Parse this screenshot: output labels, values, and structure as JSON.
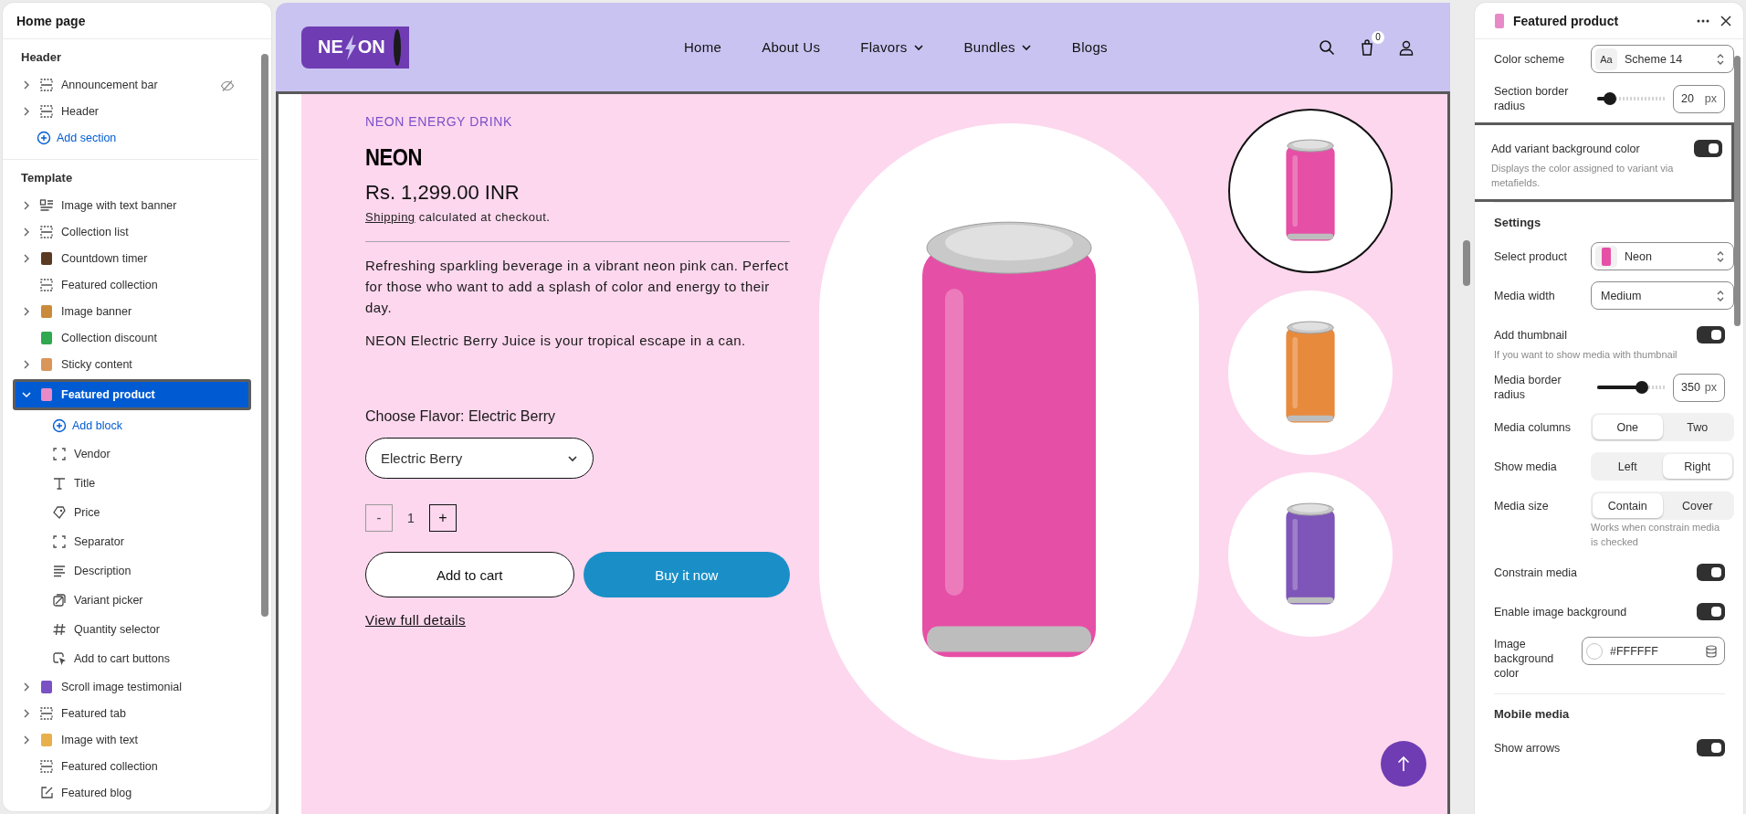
{
  "sidebar": {
    "title": "Home page",
    "groups": [
      {
        "title": "Header",
        "add_label": "Add section",
        "items": [
          {
            "label": "Announcement bar",
            "kind": "section",
            "expanded": false,
            "hidden": true,
            "selected": false
          },
          {
            "label": "Header",
            "kind": "section",
            "expanded": false,
            "hidden": false,
            "selected": false
          }
        ]
      },
      {
        "title": "Template",
        "items": [
          {
            "label": "Image with text banner",
            "kind": "image-text",
            "expanded": false,
            "hidden": false,
            "selected": false
          },
          {
            "label": "Collection list",
            "kind": "section",
            "expanded": false,
            "hidden": false,
            "selected": false
          },
          {
            "label": "Countdown timer",
            "kind": "thumb",
            "color": "#5a3a22",
            "expanded": false,
            "hidden": false,
            "selected": false
          },
          {
            "label": "Featured collection",
            "kind": "section",
            "hidden": false,
            "selected": false
          },
          {
            "label": "Image banner",
            "kind": "thumb",
            "color": "#c98a3a",
            "expanded": false,
            "hidden": false,
            "selected": false
          },
          {
            "label": "Collection discount",
            "kind": "thumb",
            "color": "#2fa84f",
            "hidden": false,
            "selected": false
          },
          {
            "label": "Sticky content",
            "kind": "thumb",
            "color": "#d9965a",
            "expanded": false,
            "hidden": false,
            "selected": false
          },
          {
            "label": "Featured product",
            "kind": "thumb",
            "color": "#e98ac8",
            "expanded": true,
            "hidden": false,
            "selected": true,
            "add_label": "Add block",
            "children": [
              {
                "label": "Vendor",
                "kind": "block",
                "selected": false
              },
              {
                "label": "Title",
                "kind": "text",
                "selected": false
              },
              {
                "label": "Price",
                "kind": "price",
                "selected": false
              },
              {
                "label": "Separator",
                "kind": "block",
                "selected": false
              },
              {
                "label": "Description",
                "kind": "description",
                "selected": false
              },
              {
                "label": "Variant picker",
                "kind": "variant",
                "selected": false
              },
              {
                "label": "Quantity selector",
                "kind": "hash",
                "selected": false
              },
              {
                "label": "Add to cart buttons",
                "kind": "cursor",
                "selected": false
              }
            ]
          },
          {
            "label": "Scroll image testimonial",
            "kind": "thumb",
            "color": "#7a52c4",
            "expanded": false,
            "hidden": false,
            "selected": false
          },
          {
            "label": "Featured tab",
            "kind": "section",
            "expanded": false,
            "hidden": false,
            "selected": false
          },
          {
            "label": "Image with text",
            "kind": "thumb",
            "color": "#e8b04a",
            "expanded": false,
            "hidden": false,
            "selected": false
          },
          {
            "label": "Featured collection",
            "kind": "section",
            "hidden": false,
            "selected": false
          },
          {
            "label": "Featured blog",
            "kind": "edit",
            "hidden": false,
            "selected": false
          }
        ]
      }
    ]
  },
  "store": {
    "logo": {
      "left": "NE",
      "right": "ON"
    },
    "nav": [
      {
        "label": "Home",
        "dropdown": false
      },
      {
        "label": "About Us",
        "dropdown": false
      },
      {
        "label": "Flavors",
        "dropdown": true
      },
      {
        "label": "Bundles",
        "dropdown": true
      },
      {
        "label": "Blogs",
        "dropdown": false
      }
    ],
    "cart_count": "0",
    "product": {
      "vendor": "NEON ENERGY DRINK",
      "title": "NEON",
      "price": "Rs. 1,299.00 INR",
      "shipping_link": "Shipping",
      "shipping_text": "calculated at checkout.",
      "description": [
        "Refreshing sparkling beverage in a vibrant neon pink can. Perfect for those who want to add a splash of color and energy to their day.",
        "NEON Electric Berry Juice is your tropical escape in a can."
      ],
      "option_label": "Choose Flavor:",
      "option_value": "Electric Berry",
      "select_value": "Electric Berry",
      "minus": "-",
      "quantity": "1",
      "plus": "+",
      "add_to_cart": "Add to cart",
      "buy_now": "Buy it now",
      "details_link": "View full details",
      "thumbnails": [
        {
          "color": "#e64fa6",
          "selected": true
        },
        {
          "color": "#e88a3c",
          "selected": false
        },
        {
          "color": "#7e55b8",
          "selected": false
        }
      ]
    }
  },
  "panel": {
    "title": "Featured product",
    "settings": [
      {
        "kind": "select",
        "label": "Color scheme",
        "value": "Scheme 14",
        "badge": "Aa",
        "highlighted": false
      },
      {
        "kind": "slider",
        "label": "Section border radius",
        "level": 0.18,
        "value": "20",
        "unit": "px",
        "highlighted": false
      },
      {
        "kind": "toggle",
        "label": "Add variant background color",
        "on": true,
        "help": "Displays the color assigned to variant via metafields.",
        "highlighted": true
      },
      {
        "kind": "heading",
        "label": "Settings",
        "highlighted": false
      },
      {
        "kind": "select",
        "label": "Select product",
        "value": "Neon",
        "highlighted": false
      },
      {
        "kind": "select",
        "label": "Media width",
        "value": "Medium",
        "highlighted": false
      },
      {
        "kind": "toggle",
        "label": "Add thumbnail",
        "on": true,
        "help": "If you want to show media with thumbnail",
        "highlighted": false
      },
      {
        "kind": "slider",
        "label": "Media border radius",
        "level": 0.65,
        "value": "350",
        "unit": "px",
        "highlighted": false
      },
      {
        "kind": "segmented",
        "label": "Media columns",
        "options": [
          {
            "label": "One",
            "selected": true
          },
          {
            "label": "Two",
            "selected": false
          }
        ],
        "highlighted": false
      },
      {
        "kind": "segmented",
        "label": "Show media",
        "options": [
          {
            "label": "Left",
            "selected": false
          },
          {
            "label": "Right",
            "selected": true
          }
        ],
        "highlighted": false
      },
      {
        "kind": "segmented",
        "label": "Media size",
        "options": [
          {
            "label": "Contain",
            "selected": true
          },
          {
            "label": "Cover",
            "selected": false
          }
        ],
        "note": "Works when constrain media is checked",
        "highlighted": false
      },
      {
        "kind": "toggle",
        "label": "Constrain media",
        "on": true,
        "highlighted": false
      },
      {
        "kind": "toggle",
        "label": "Enable image background",
        "on": true,
        "highlighted": false
      },
      {
        "kind": "color",
        "label": "Image background color",
        "value": "#FFFFFF",
        "highlighted": false
      },
      {
        "kind": "heading",
        "label": "Mobile media",
        "highlighted": false
      },
      {
        "kind": "toggle",
        "label": "Show arrows",
        "on": true,
        "highlighted": false
      }
    ]
  }
}
